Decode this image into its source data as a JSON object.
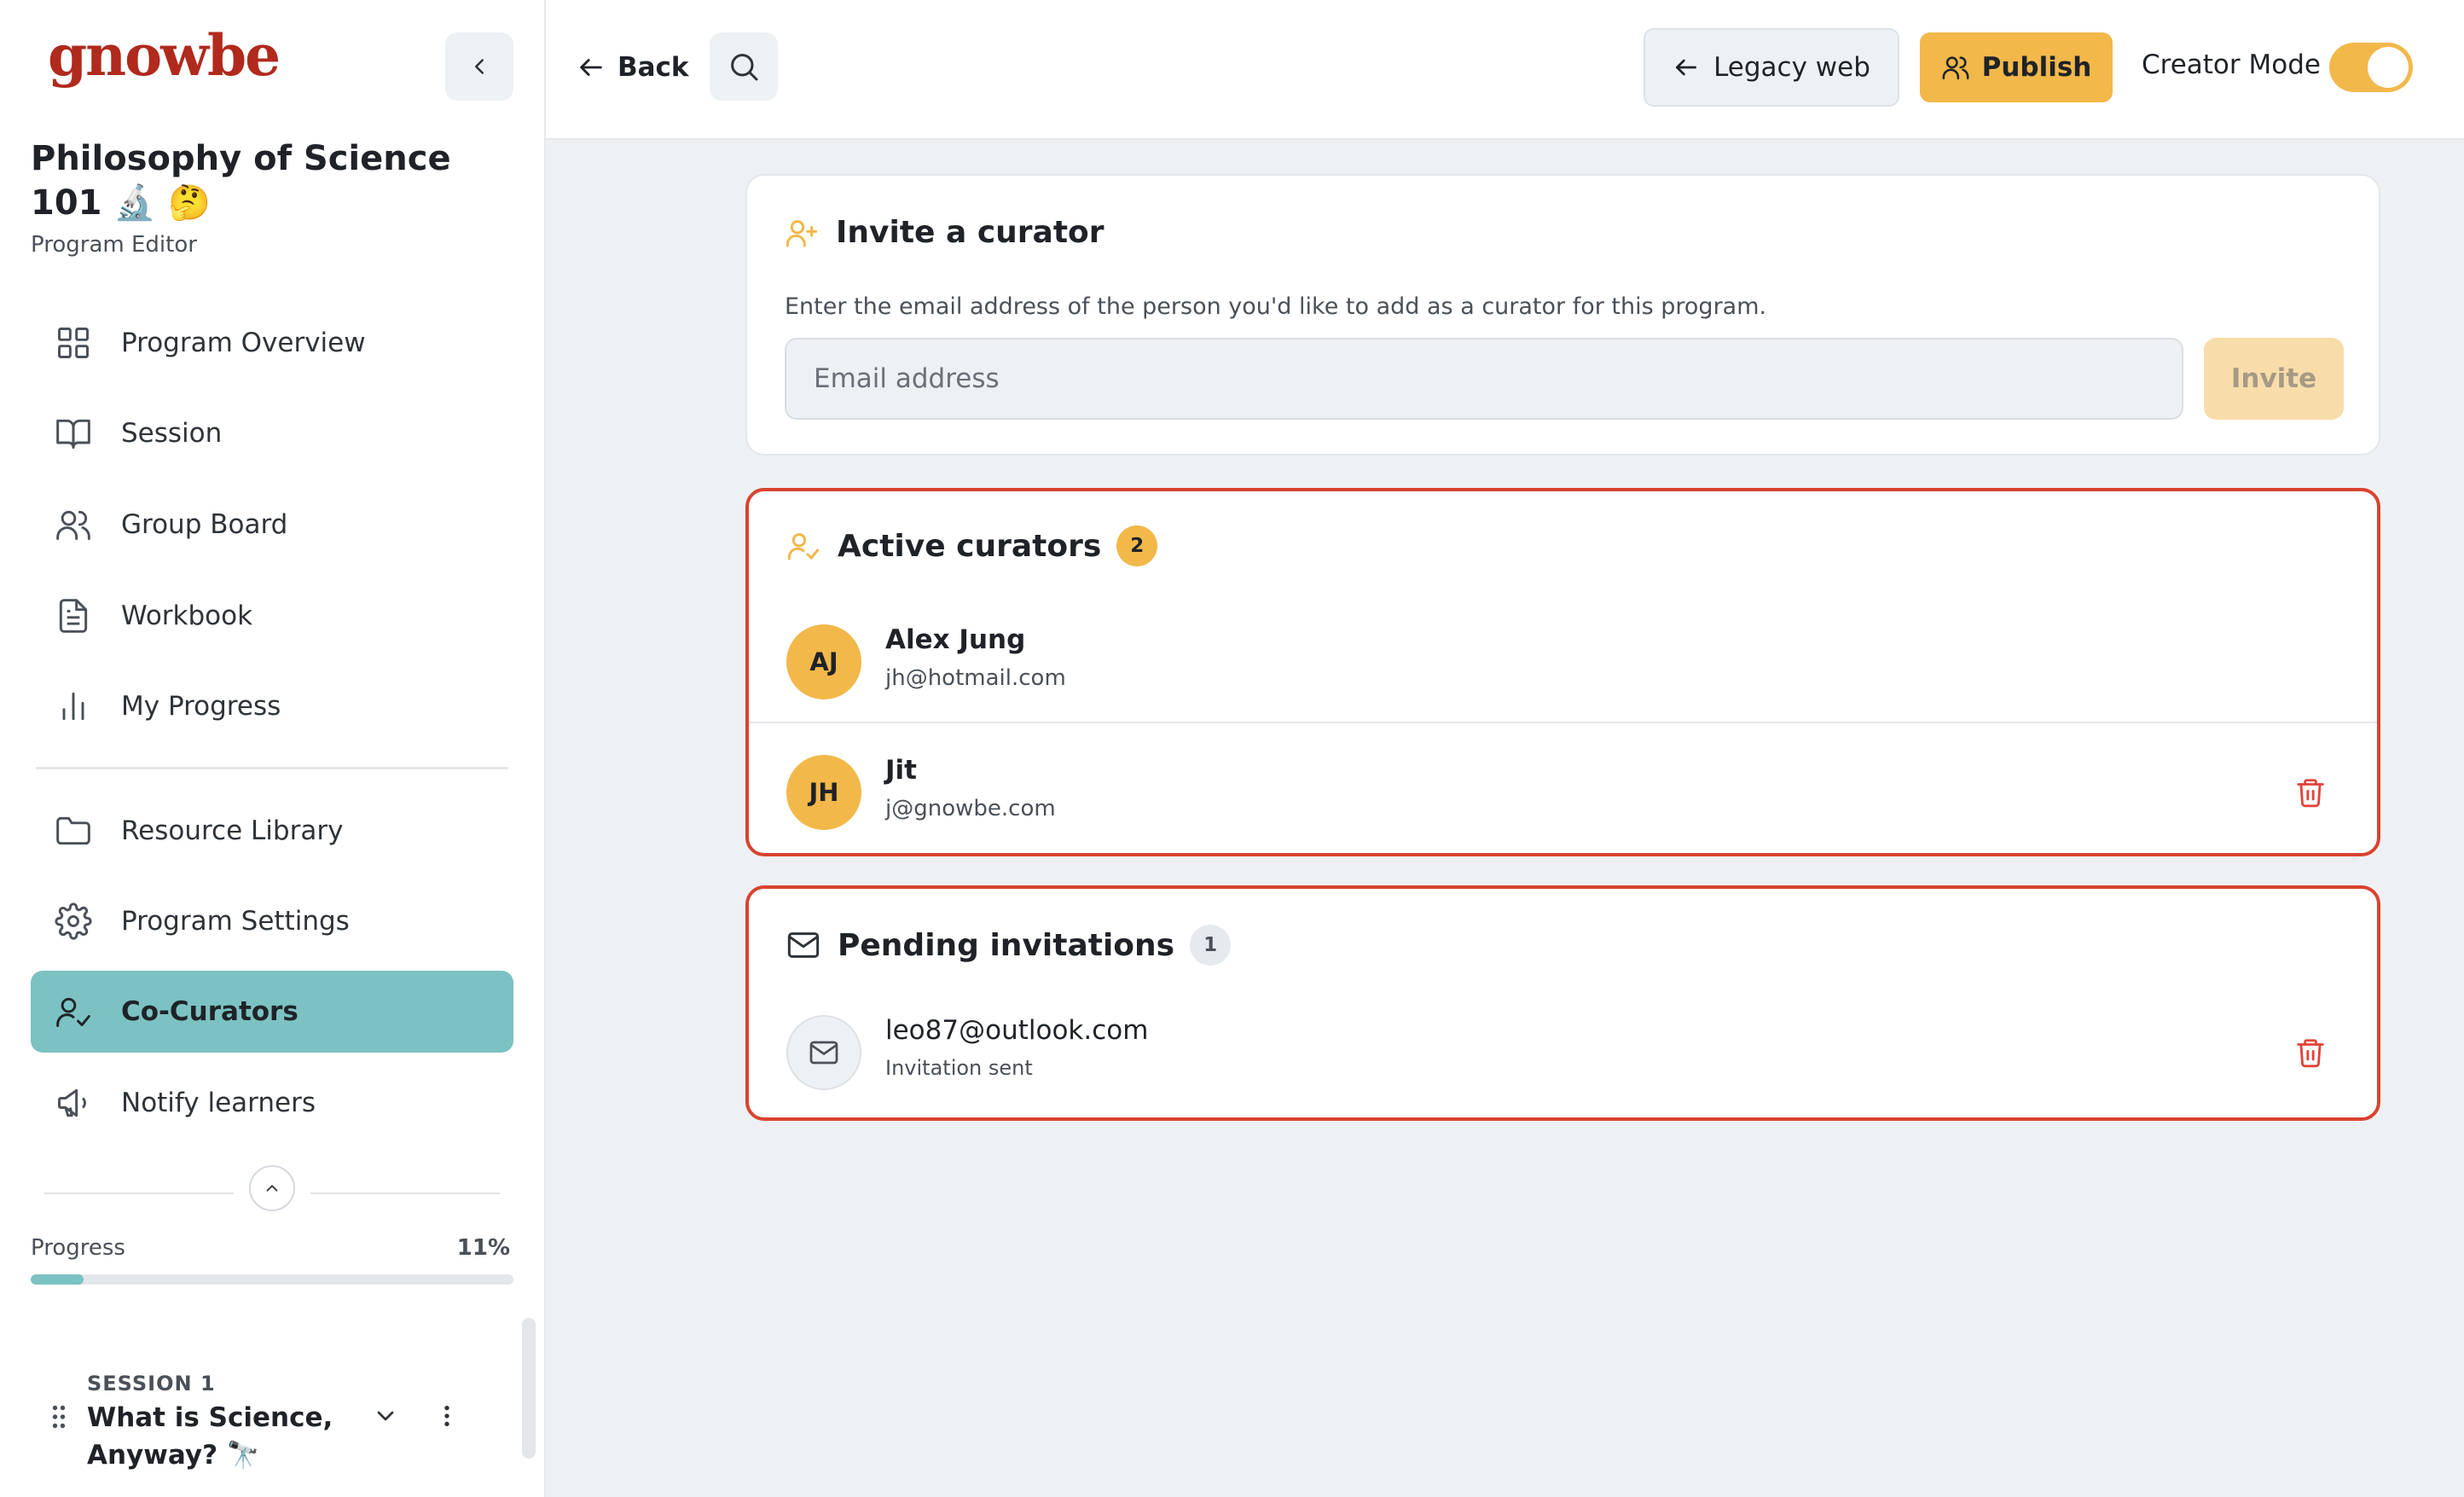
{
  "app": {
    "logo": "gnowbe"
  },
  "program": {
    "title": "Philosophy of Science 101 🔬 🤔",
    "subtitle": "Program Editor"
  },
  "sidebar": {
    "items": [
      {
        "label": "Program Overview",
        "icon": "grid-icon"
      },
      {
        "label": "Session",
        "icon": "book-icon"
      },
      {
        "label": "Group Board",
        "icon": "users-icon"
      },
      {
        "label": "Workbook",
        "icon": "document-icon"
      },
      {
        "label": "My Progress",
        "icon": "bar-chart-icon"
      },
      {
        "label": "Resource Library",
        "icon": "folder-icon"
      },
      {
        "label": "Program Settings",
        "icon": "gear-icon"
      },
      {
        "label": "Co-Curators",
        "icon": "user-check-icon",
        "active": true
      },
      {
        "label": "Notify learners",
        "icon": "megaphone-icon"
      }
    ],
    "progress": {
      "label": "Progress",
      "value_text": "11%",
      "value": 0.11
    },
    "session": {
      "number": "SESSION 1",
      "title": "What is Science, Anyway? 🔭"
    }
  },
  "topbar": {
    "back_label": "Back",
    "legacy_label": "Legacy web",
    "publish_label": "Publish",
    "creator_mode_label": "Creator Mode",
    "creator_mode_on": true
  },
  "invite": {
    "title": "Invite a curator",
    "description": "Enter the email address of the person you'd like to add as a curator for this program.",
    "placeholder": "Email address",
    "value": "",
    "button_label": "Invite"
  },
  "active_curators": {
    "title": "Active curators",
    "count": "2",
    "items": [
      {
        "initials": "AJ",
        "name": "Alex Jung",
        "email": "jh@hotmail.com",
        "deletable": false
      },
      {
        "initials": "JH",
        "name": "Jit",
        "email": "j@gnowbe.com",
        "deletable": true
      }
    ]
  },
  "pending": {
    "title": "Pending invitations",
    "count": "1",
    "items": [
      {
        "email": "leo87@outlook.com",
        "status": "Invitation sent"
      }
    ]
  },
  "colors": {
    "accent_yellow": "#f2b84a",
    "active_teal": "#7cc2c2",
    "brand_red": "#b02a1d",
    "highlight_red": "#d9432f",
    "delete_red": "#e0443a"
  }
}
